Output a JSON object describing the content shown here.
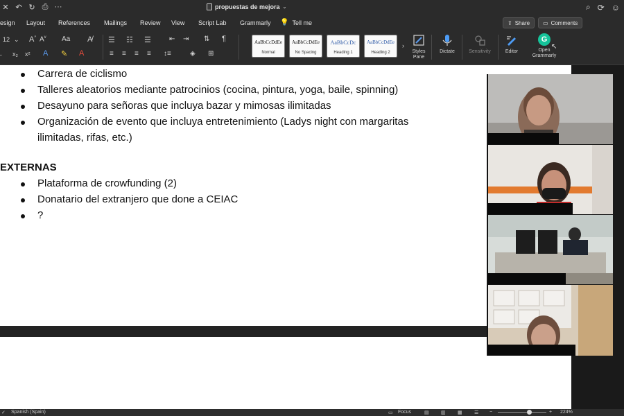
{
  "window": {
    "title": "propuestas de mejora"
  },
  "quick_access": {
    "icons": [
      "close-window-icon",
      "undo-icon",
      "redo-icon",
      "print-icon",
      "more-icon"
    ]
  },
  "tabs": [
    "esign",
    "Layout",
    "References",
    "Mailings",
    "Review",
    "View",
    "Script Lab",
    "Grammarly"
  ],
  "tell_me": "Tell me",
  "share_label": "Share",
  "comments_label": "Comments",
  "ribbon": {
    "font_size": "12",
    "styles": [
      {
        "preview": "AaBbCcDdEe",
        "name": "Normal"
      },
      {
        "preview": "AaBbCcDdEe",
        "name": "No Spacing"
      },
      {
        "preview": "AaBbCcDc",
        "name": "Heading 1"
      },
      {
        "preview": "AaBbCcDdEe",
        "name": "Heading 2"
      }
    ],
    "styles_pane_label_1": "Styles",
    "styles_pane_label_2": "Pane",
    "dictate_label": "Dictate",
    "sensitivity_label": "Sensitivity",
    "editor_label": "Editor",
    "open_grammarly_label_1": "Open",
    "open_grammarly_label_2": "Grammarly",
    "grammarly_letter": "G"
  },
  "document": {
    "bullets_top": [
      "Carrera de ciclismo",
      "Talleres aleatorios mediante patrocinios (cocina, pintura, yoga, baile, spinning)",
      "Desayuno para señoras que incluya bazar y mimosas ilimitadas",
      "Organización de evento que incluya entretenimiento (Ladys night con margaritas",
      "ilimitadas, rifas, etc.)"
    ],
    "heading_externas": "EXTERNAS",
    "bullets_externas": [
      "Plataforma de crowfunding (2)",
      "Donatario del extranjero que done a CEIAC",
      "?"
    ]
  },
  "status_bar": {
    "language": "Spanish (Spain)",
    "focus": "Focus",
    "zoom": "224%"
  },
  "colors": {
    "grammarly": "#15c39a",
    "ribbon_bg": "#2b2b2b",
    "heading_blue": "#2e5aa7"
  }
}
